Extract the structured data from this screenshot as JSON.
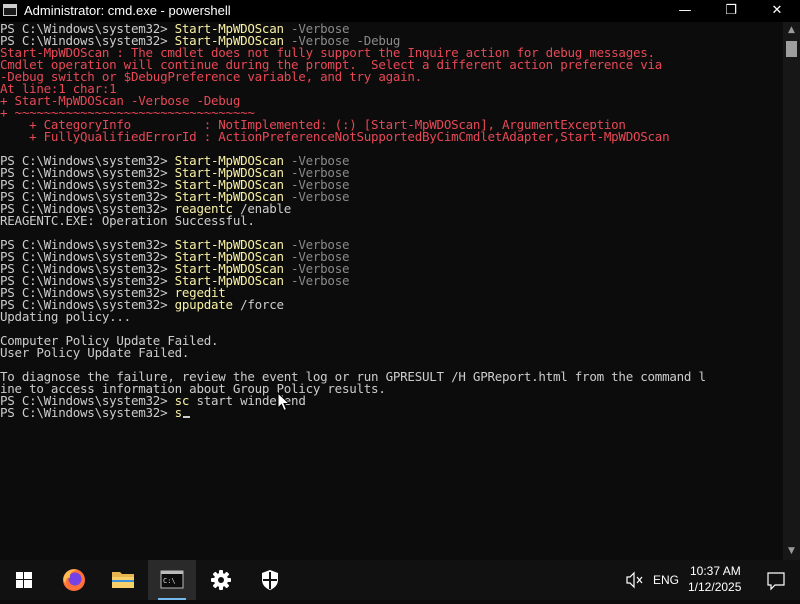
{
  "window": {
    "title": "Administrator: cmd.exe - powershell",
    "minimize_glyph": "—",
    "maximize_glyph": "❐",
    "close_glyph": "✕"
  },
  "terminal": {
    "lines": [
      {
        "segments": [
          {
            "text": "PS C:\\Windows\\system32> ",
            "style": "white"
          },
          {
            "text": "Start-MpWDOScan",
            "style": "yellow"
          },
          {
            "text": " -Verbose",
            "style": "gray"
          }
        ]
      },
      {
        "segments": [
          {
            "text": "PS C:\\Windows\\system32> ",
            "style": "white"
          },
          {
            "text": "Start-MpWDOScan",
            "style": "yellow"
          },
          {
            "text": " -Verbose -Debug",
            "style": "gray"
          }
        ]
      },
      {
        "segments": [
          {
            "text": "Start-MpWDOScan : The cmdlet does not fully support the Inquire action for debug messages.",
            "style": "red"
          }
        ]
      },
      {
        "segments": [
          {
            "text": "Cmdlet operation will continue during the prompt.  Select a different action preference via",
            "style": "red"
          }
        ]
      },
      {
        "segments": [
          {
            "text": "-Debug switch or $DebugPreference variable, and try again.",
            "style": "red"
          }
        ]
      },
      {
        "segments": [
          {
            "text": "At line:1 char:1",
            "style": "red"
          }
        ]
      },
      {
        "segments": [
          {
            "text": "+ Start-MpWDOScan -Verbose -Debug",
            "style": "red"
          }
        ]
      },
      {
        "segments": [
          {
            "text": "+ ~~~~~~~~~~~~~~~~~~~~~~~~~~~~~~~~~",
            "style": "red"
          }
        ]
      },
      {
        "segments": [
          {
            "text": "    + CategoryInfo          : NotImplemented: (:) [Start-MpWDOScan], ArgumentException",
            "style": "red"
          }
        ]
      },
      {
        "segments": [
          {
            "text": "    + FullyQualifiedErrorId : ActionPreferenceNotSupportedByCimCmdletAdapter,Start-MpWDOScan",
            "style": "red"
          }
        ]
      },
      {
        "segments": []
      },
      {
        "segments": [
          {
            "text": "PS C:\\Windows\\system32> ",
            "style": "white"
          },
          {
            "text": "Start-MpWDOScan",
            "style": "yellow"
          },
          {
            "text": " -Verbose",
            "style": "gray"
          }
        ]
      },
      {
        "segments": [
          {
            "text": "PS C:\\Windows\\system32> ",
            "style": "white"
          },
          {
            "text": "Start-MpWDOScan",
            "style": "yellow"
          },
          {
            "text": " -Verbose",
            "style": "gray"
          }
        ]
      },
      {
        "segments": [
          {
            "text": "PS C:\\Windows\\system32> ",
            "style": "white"
          },
          {
            "text": "Start-MpWDOScan",
            "style": "yellow"
          },
          {
            "text": " -Verbose",
            "style": "gray"
          }
        ]
      },
      {
        "segments": [
          {
            "text": "PS C:\\Windows\\system32> ",
            "style": "white"
          },
          {
            "text": "Start-MpWDOScan",
            "style": "yellow"
          },
          {
            "text": " -Verbose",
            "style": "gray"
          }
        ]
      },
      {
        "segments": [
          {
            "text": "PS C:\\Windows\\system32> ",
            "style": "white"
          },
          {
            "text": "reagentc",
            "style": "yellow"
          },
          {
            "text": " /enable",
            "style": "white"
          }
        ]
      },
      {
        "segments": [
          {
            "text": "REAGENTC.EXE: Operation Successful.",
            "style": "white"
          }
        ]
      },
      {
        "segments": []
      },
      {
        "segments": [
          {
            "text": "PS C:\\Windows\\system32> ",
            "style": "white"
          },
          {
            "text": "Start-MpWDOScan",
            "style": "yellow"
          },
          {
            "text": " -Verbose",
            "style": "gray"
          }
        ]
      },
      {
        "segments": [
          {
            "text": "PS C:\\Windows\\system32> ",
            "style": "white"
          },
          {
            "text": "Start-MpWDOScan",
            "style": "yellow"
          },
          {
            "text": " -Verbose",
            "style": "gray"
          }
        ]
      },
      {
        "segments": [
          {
            "text": "PS C:\\Windows\\system32> ",
            "style": "white"
          },
          {
            "text": "Start-MpWDOScan",
            "style": "yellow"
          },
          {
            "text": " -Verbose",
            "style": "gray"
          }
        ]
      },
      {
        "segments": [
          {
            "text": "PS C:\\Windows\\system32> ",
            "style": "white"
          },
          {
            "text": "Start-MpWDOScan",
            "style": "yellow"
          },
          {
            "text": " -Verbose",
            "style": "gray"
          }
        ]
      },
      {
        "segments": [
          {
            "text": "PS C:\\Windows\\system32> ",
            "style": "white"
          },
          {
            "text": "regedit",
            "style": "yellow"
          }
        ]
      },
      {
        "segments": [
          {
            "text": "PS C:\\Windows\\system32> ",
            "style": "white"
          },
          {
            "text": "gpupdate",
            "style": "yellow"
          },
          {
            "text": " /force",
            "style": "white"
          }
        ]
      },
      {
        "segments": [
          {
            "text": "Updating policy...",
            "style": "white"
          }
        ]
      },
      {
        "segments": []
      },
      {
        "segments": [
          {
            "text": "Computer Policy Update Failed.",
            "style": "white"
          }
        ]
      },
      {
        "segments": [
          {
            "text": "User Policy Update Failed.",
            "style": "white"
          }
        ]
      },
      {
        "segments": []
      },
      {
        "segments": [
          {
            "text": "To diagnose the failure, review the event log or run GPRESULT /H GPReport.html from the command l",
            "style": "white"
          }
        ]
      },
      {
        "segments": [
          {
            "text": "ine to access information about Group Policy results.",
            "style": "white"
          }
        ]
      },
      {
        "segments": [
          {
            "text": "PS C:\\Windows\\system32> ",
            "style": "white"
          },
          {
            "text": "sc",
            "style": "yellow"
          },
          {
            "text": " start windefend",
            "style": "white"
          }
        ]
      },
      {
        "segments": [
          {
            "text": "PS C:\\Windows\\system32> ",
            "style": "white"
          },
          {
            "text": "s",
            "style": "yellow"
          }
        ],
        "cursor": true
      }
    ]
  },
  "taskbar": {
    "items": [
      {
        "name": "start-button",
        "icon": "windows-logo-icon"
      },
      {
        "name": "taskbar-firefox",
        "icon": "firefox-icon"
      },
      {
        "name": "taskbar-file-explorer",
        "icon": "folder-icon"
      },
      {
        "name": "taskbar-cmd",
        "icon": "terminal-icon",
        "active": true
      },
      {
        "name": "taskbar-settings",
        "icon": "gear-icon"
      },
      {
        "name": "taskbar-defender",
        "icon": "shield-icon"
      }
    ],
    "tray": {
      "volume_icon": "muted-speaker-icon",
      "language": "ENG",
      "time": "10:37 AM",
      "date": "1/12/2025",
      "notification_icon": "notification-icon"
    }
  },
  "colors": {
    "terminal_bg": "#0c0c0c",
    "text_white": "#cccccc",
    "text_red": "#e74856",
    "text_yellow": "#f9f1a5",
    "text_gray": "#8a8a8a",
    "taskbar_bg": "#111111",
    "accent": "#76b9ed"
  }
}
